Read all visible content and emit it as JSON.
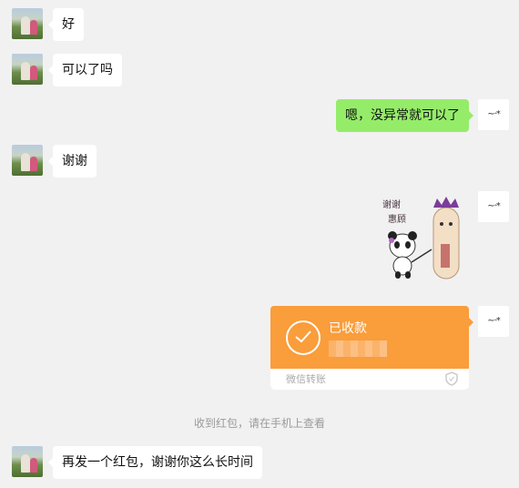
{
  "messages": {
    "m1": "好",
    "m2": "可以了吗",
    "m3": "嗯，没异常就可以了",
    "m4": "谢谢",
    "m5": "再发一个红包，谢谢你这么长时间"
  },
  "sticker": {
    "text_line1": "谢谢",
    "text_line2": "惠顾"
  },
  "transfer": {
    "status": "已收款",
    "label": "微信转账"
  },
  "system": {
    "notice": "收到红包，请在手机上查看"
  },
  "avatars": {
    "self_glyph": "~·*"
  },
  "colors": {
    "background": "#f1f1f1",
    "outgoing_bubble": "#95ec69",
    "incoming_bubble": "#ffffff",
    "transfer_orange": "#fa9d3b"
  }
}
